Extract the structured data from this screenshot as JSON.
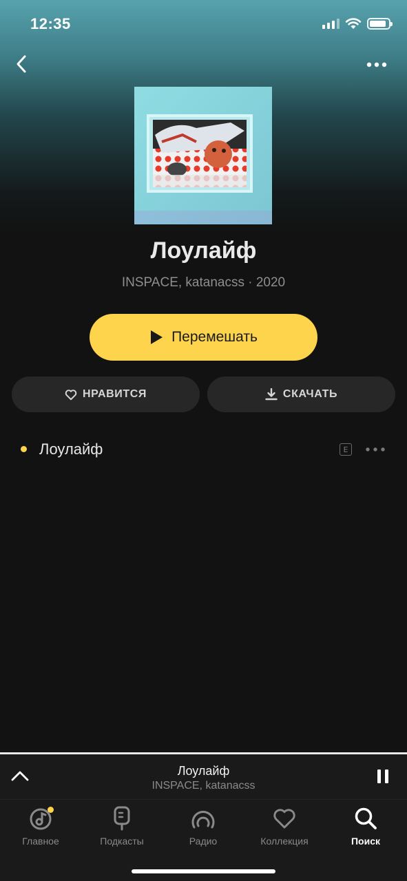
{
  "status_bar": {
    "time": "12:35",
    "battery_level": 0.9
  },
  "header": {
    "back_icon": "chevron-left-icon",
    "more_icon": "more-horizontal-icon"
  },
  "album": {
    "title": "Лоулайф",
    "subtitle": "INSPACE, katanacss · 2020"
  },
  "actions": {
    "shuffle_label": "Перемешать",
    "like_label": "НРАВИТСЯ",
    "download_label": "СКАЧАТЬ"
  },
  "tracks": [
    {
      "title": "Лоулайф",
      "explicit_badge": "E",
      "playing": true
    }
  ],
  "mini_player": {
    "title": "Лоулайф",
    "artist": "INSPACE, katanacss"
  },
  "tabs": [
    {
      "label": "Главное",
      "icon": "music-note-disc-icon",
      "has_badge": true,
      "active": false
    },
    {
      "label": "Подкасты",
      "icon": "microphone-icon",
      "active": false
    },
    {
      "label": "Радио",
      "icon": "radio-waves-icon",
      "active": false
    },
    {
      "label": "Коллекция",
      "icon": "heart-icon",
      "active": false
    },
    {
      "label": "Поиск",
      "icon": "search-icon",
      "active": true
    }
  ],
  "colors": {
    "accent": "#fed44d",
    "background": "#121212",
    "header_tint": "#57a2ad"
  }
}
